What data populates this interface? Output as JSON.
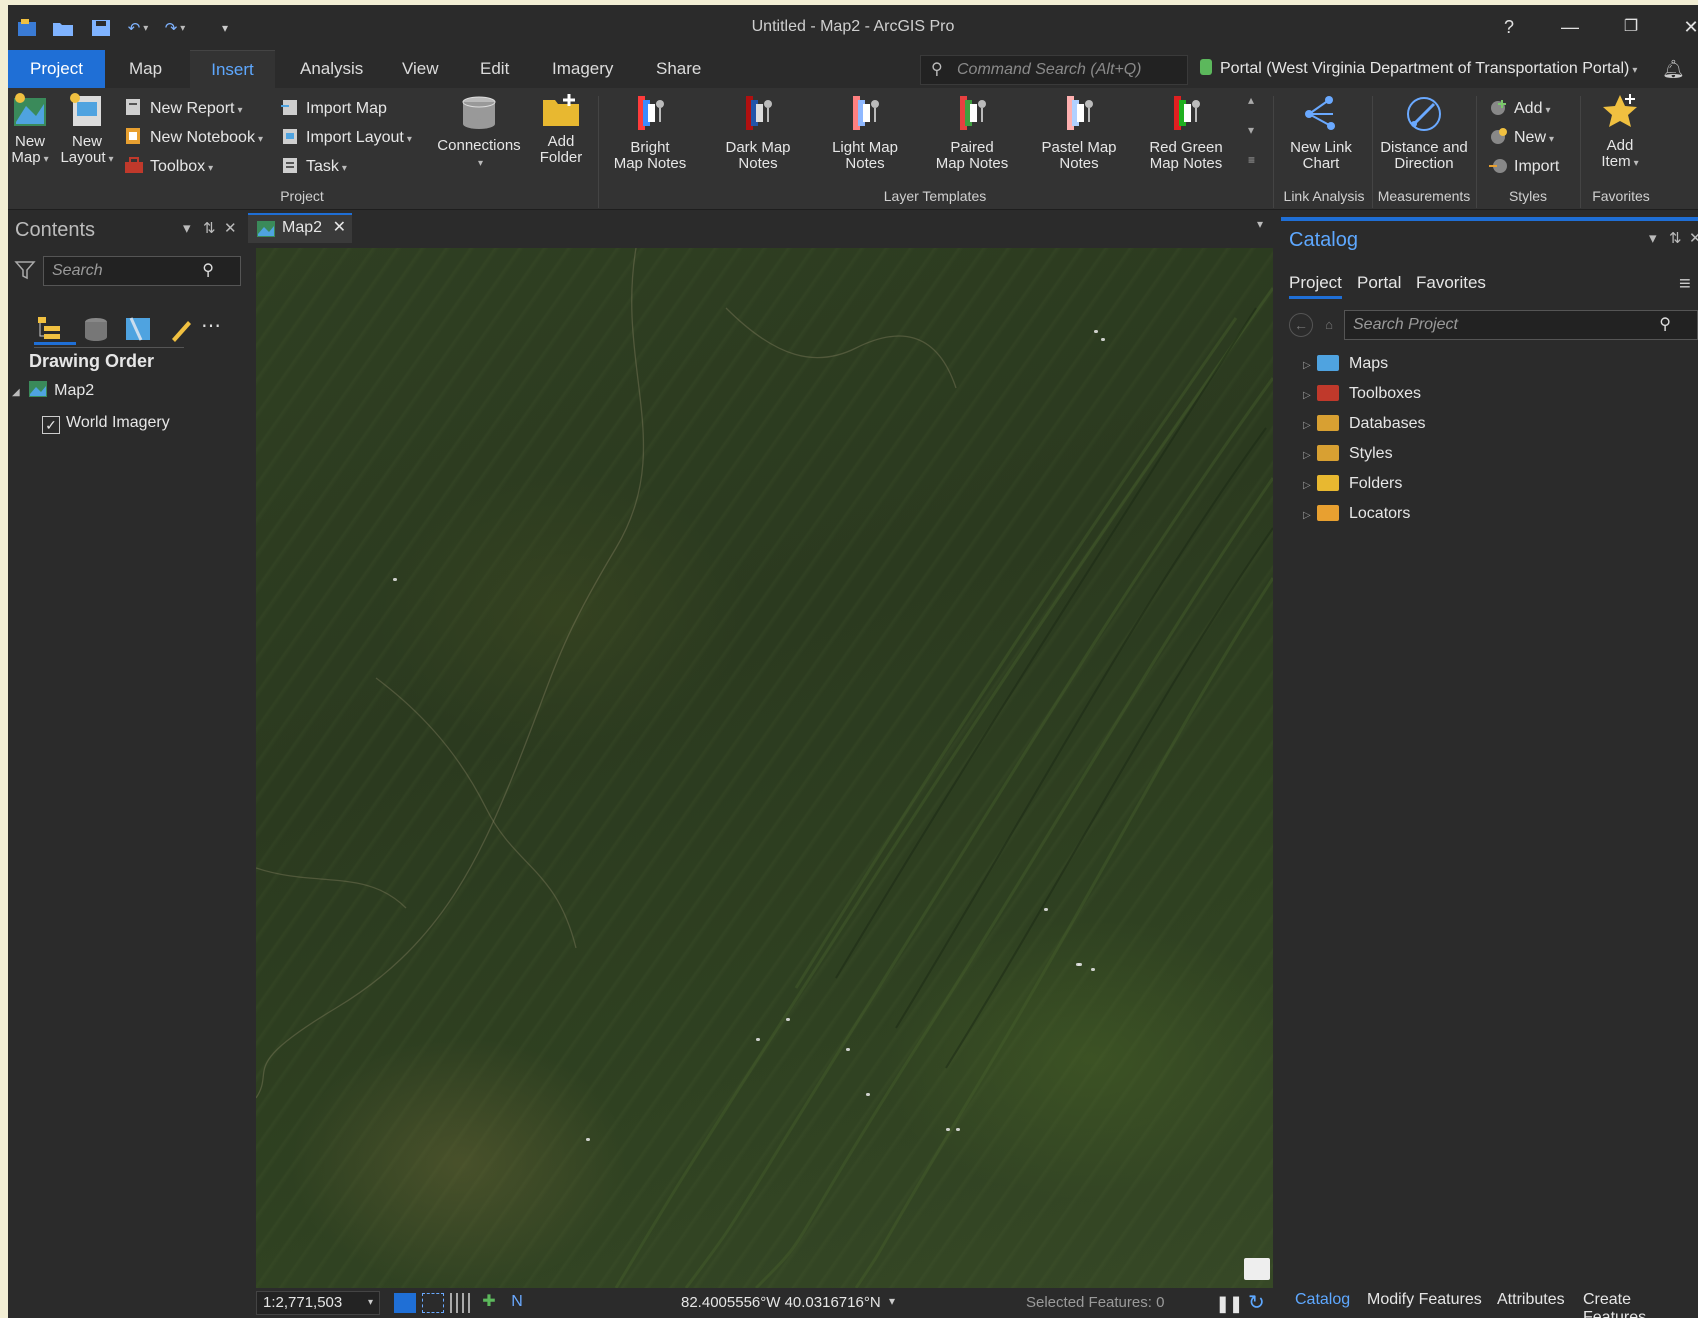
{
  "window": {
    "title": "Untitled - Map2 - ArcGIS Pro",
    "help": "?",
    "minimize": "—",
    "restore": "❐",
    "close": "✕"
  },
  "ribbon_tabs": [
    "Project",
    "Map",
    "Insert",
    "Analysis",
    "View",
    "Edit",
    "Imagery",
    "Share"
  ],
  "active_tab": "Insert",
  "command_search": {
    "placeholder": "Command Search (Alt+Q)"
  },
  "portal": {
    "label": "Portal (West Virginia Department of Transportation Portal)"
  },
  "ribbon": {
    "new_map": "New Map",
    "new_layout": "New Layout",
    "new_report": "New Report",
    "new_notebook": "New Notebook",
    "toolbox": "Toolbox",
    "import_map": "Import Map",
    "import_layout": "Import Layout",
    "task": "Task",
    "connections": "Connections",
    "add_folder_1": "Add",
    "add_folder_2": "Folder",
    "group_project": "Project",
    "templates": [
      {
        "l1": "Bright",
        "l2": "Map Notes",
        "colors": [
          "#ff3b3b",
          "#3b8bff",
          "#ffffff"
        ]
      },
      {
        "l1": "Dark Map",
        "l2": "Notes",
        "colors": [
          "#b01010",
          "#2255aa",
          "#dddddd"
        ]
      },
      {
        "l1": "Light Map",
        "l2": "Notes",
        "colors": [
          "#ff8080",
          "#8fb8ff",
          "#ffffff"
        ]
      },
      {
        "l1": "Paired",
        "l2": "Map Notes",
        "colors": [
          "#e84040",
          "#40a040",
          "#ffffff"
        ]
      },
      {
        "l1": "Pastel Map",
        "l2": "Notes",
        "colors": [
          "#ffb0b0",
          "#b0d0ff",
          "#ffffff"
        ]
      },
      {
        "l1": "Red Green",
        "l2": "Map Notes",
        "colors": [
          "#e02020",
          "#20b020",
          "#ffffff"
        ]
      }
    ],
    "group_layer_templates": "Layer Templates",
    "new_link_chart_1": "New Link",
    "new_link_chart_2": "Chart",
    "group_link_analysis": "Link Analysis",
    "distance_1": "Distance and",
    "distance_2": "Direction",
    "group_measurements": "Measurements",
    "styles_add": "Add",
    "styles_new": "New",
    "styles_import": "Import",
    "group_styles": "Styles",
    "add_item_1": "Add",
    "add_item_2": "Item",
    "group_favorites": "Favorites"
  },
  "contents": {
    "title": "Contents",
    "search_placeholder": "Search",
    "drawing_order": "Drawing Order",
    "map": "Map2",
    "layer": "World Imagery"
  },
  "map_view": {
    "tab": "Map2",
    "scale": "1:2,771,503",
    "coordinates": "82.4005556°W 40.0316716°N",
    "selected_features": "Selected Features: 0"
  },
  "catalog": {
    "title": "Catalog",
    "tabs": [
      "Project",
      "Portal",
      "Favorites"
    ],
    "search_placeholder": "Search Project",
    "items": [
      "Maps",
      "Toolboxes",
      "Databases",
      "Styles",
      "Folders",
      "Locators"
    ]
  },
  "bottom_tabs": [
    "Catalog",
    "Modify Features",
    "Attributes",
    "Create Features"
  ],
  "colors": {
    "accent": "#1f6fd6",
    "accent_text": "#5ea8ff",
    "background": "#2b2b2b",
    "ribbon": "#333333"
  }
}
